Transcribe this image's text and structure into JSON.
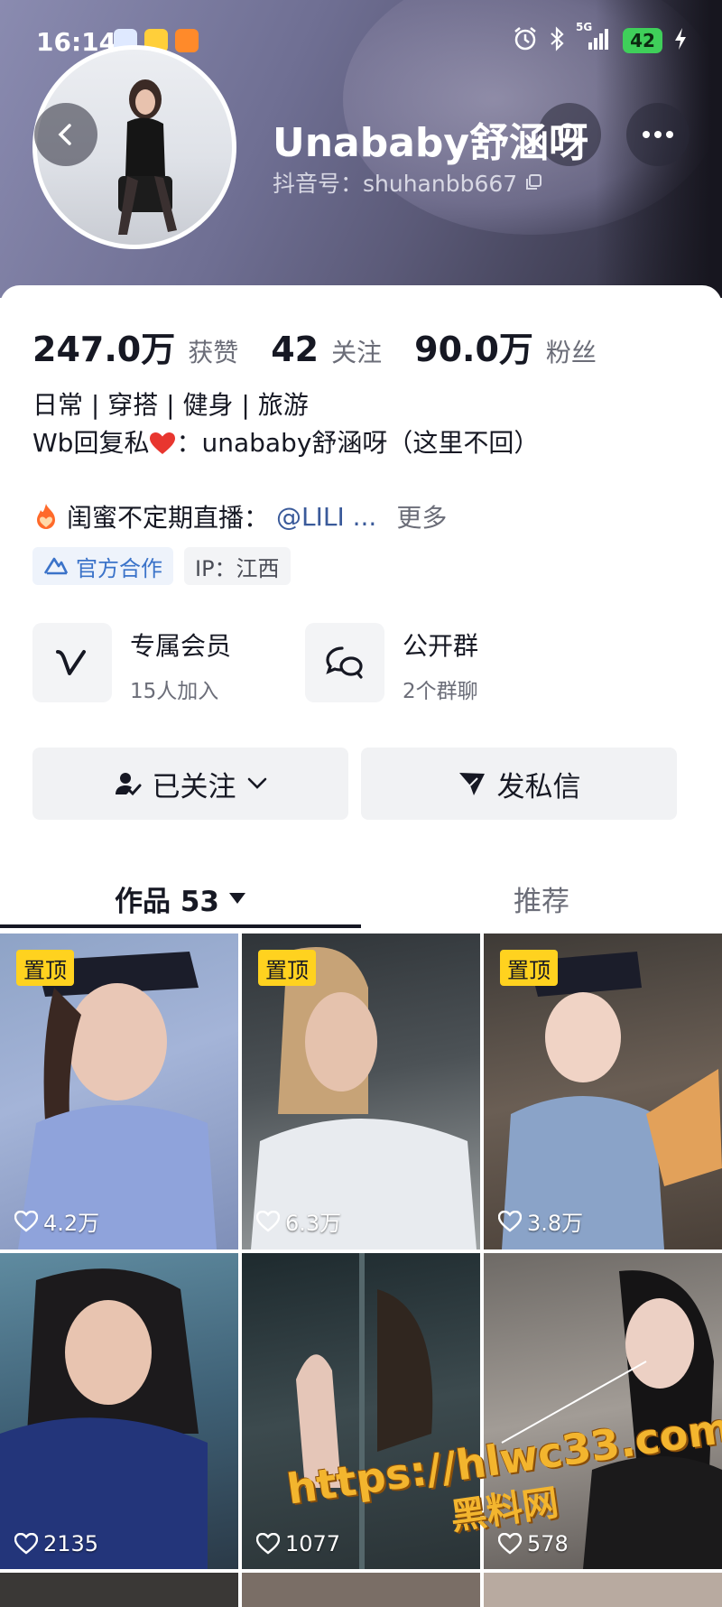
{
  "status_bar": {
    "time": "16:14",
    "network": "5G",
    "battery": "42"
  },
  "profile": {
    "nickname": "Unababy舒涵呀",
    "douyin_id": "抖音号：shuhanbb667"
  },
  "stats": [
    {
      "value": "247.0万",
      "label": "获赞"
    },
    {
      "value": "42",
      "label": "关注"
    },
    {
      "value": "90.0万",
      "label": "粉丝"
    }
  ],
  "bio": {
    "line1": "日常 | 穿搭 | 健身 | 旅游",
    "line2_prefix": "Wb回复私",
    "line2_suffix": "：unababy舒涵呀（这里不回）"
  },
  "live": {
    "text": "闺蜜不定期直播：",
    "mention": "@LILI ...",
    "more": "更多"
  },
  "tags": {
    "official": "官方合作",
    "ip": "IP：江西"
  },
  "features": [
    {
      "title": "专属会员",
      "subtitle": "15人加入",
      "icon": "v-icon"
    },
    {
      "title": "公开群",
      "subtitle": "2个群聊",
      "icon": "chat-icon"
    }
  ],
  "actions": {
    "follow": "已关注",
    "message": "发私信"
  },
  "tabs": {
    "works": "作品 53",
    "recommend": "推荐"
  },
  "videos": [
    {
      "pinned": "置顶",
      "likes": "4.2万"
    },
    {
      "pinned": "置顶",
      "likes": "6.3万"
    },
    {
      "pinned": "置顶",
      "likes": "3.8万"
    },
    {
      "pinned": "",
      "likes": "2135"
    },
    {
      "pinned": "",
      "likes": "1077"
    },
    {
      "pinned": "",
      "likes": "578"
    }
  ],
  "watermark": {
    "line1": "https://hlwc33.com",
    "line2": "黑料网"
  },
  "colors": {
    "accent_pin": "#ffd21f",
    "official_blue": "#3b73c9",
    "heart": "#fe2c55"
  }
}
